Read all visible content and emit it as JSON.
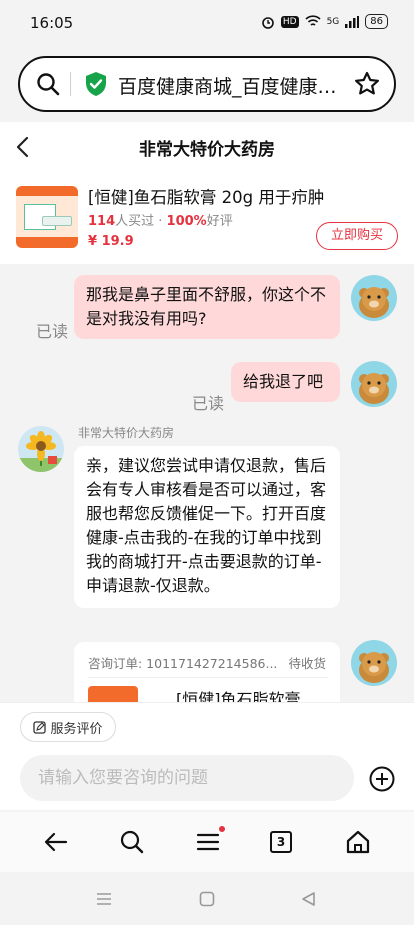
{
  "status": {
    "time": "16:05",
    "network": "5G",
    "battery": "86",
    "hd": "HD"
  },
  "browser": {
    "url_text": "百度健康商城_百度健康商城"
  },
  "header": {
    "title": "非常大特价大药房"
  },
  "product": {
    "title": "[恒健]鱼石脂软膏 20g 用于疖肿",
    "buyers_count": "114",
    "buyers_suffix": "人买过 · ",
    "rating": "100%",
    "rating_suffix": "好评",
    "price": "¥ 19.9",
    "buy_label": "立即购买"
  },
  "chat": {
    "messages": [
      {
        "side": "right",
        "text": "那我是鼻子里面不舒服，你这个不是对我没有用吗?",
        "status": "已读"
      },
      {
        "side": "right",
        "text": "给我退了吧",
        "status": "已读"
      },
      {
        "side": "left",
        "sender": "非常大特价大药房",
        "text": "亲，建议您尝试申请仅退款，售后会有专人审核看是否可以通过，客服也帮您反馈催促一下。打开百度健康-点击我的-在我的订单中找到我的商城打开-点击要退款的订单-申请退款-仅退款。"
      }
    ],
    "order_card": {
      "label": "咨询订单: 101171427214586...",
      "status": "待收货",
      "product_title": "[恒健]鱼石脂软膏"
    }
  },
  "input": {
    "review_label": "服务评价",
    "placeholder": "请输入您要咨询的问题"
  },
  "toolbar": {
    "tab_count": "3"
  }
}
